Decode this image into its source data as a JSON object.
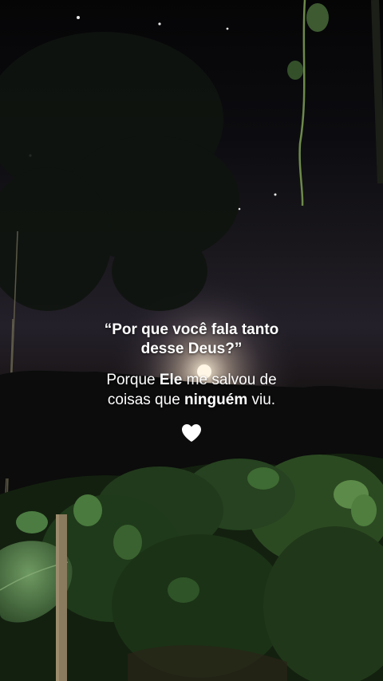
{
  "question": {
    "line1": "“Por que você fala tanto",
    "line2": "desse Deus?”"
  },
  "answer": {
    "line1_a": "Porque ",
    "line1_bold": "Ele",
    "line1_b": " me salvou de",
    "line2_a": "coisas que ",
    "line2_bold": "ninguém",
    "line2_b": " viu."
  },
  "icons": {
    "heart": "heart-icon"
  },
  "colors": {
    "text": "#ffffff",
    "foliage": "#3f6b3a",
    "sky": "#24202a"
  }
}
